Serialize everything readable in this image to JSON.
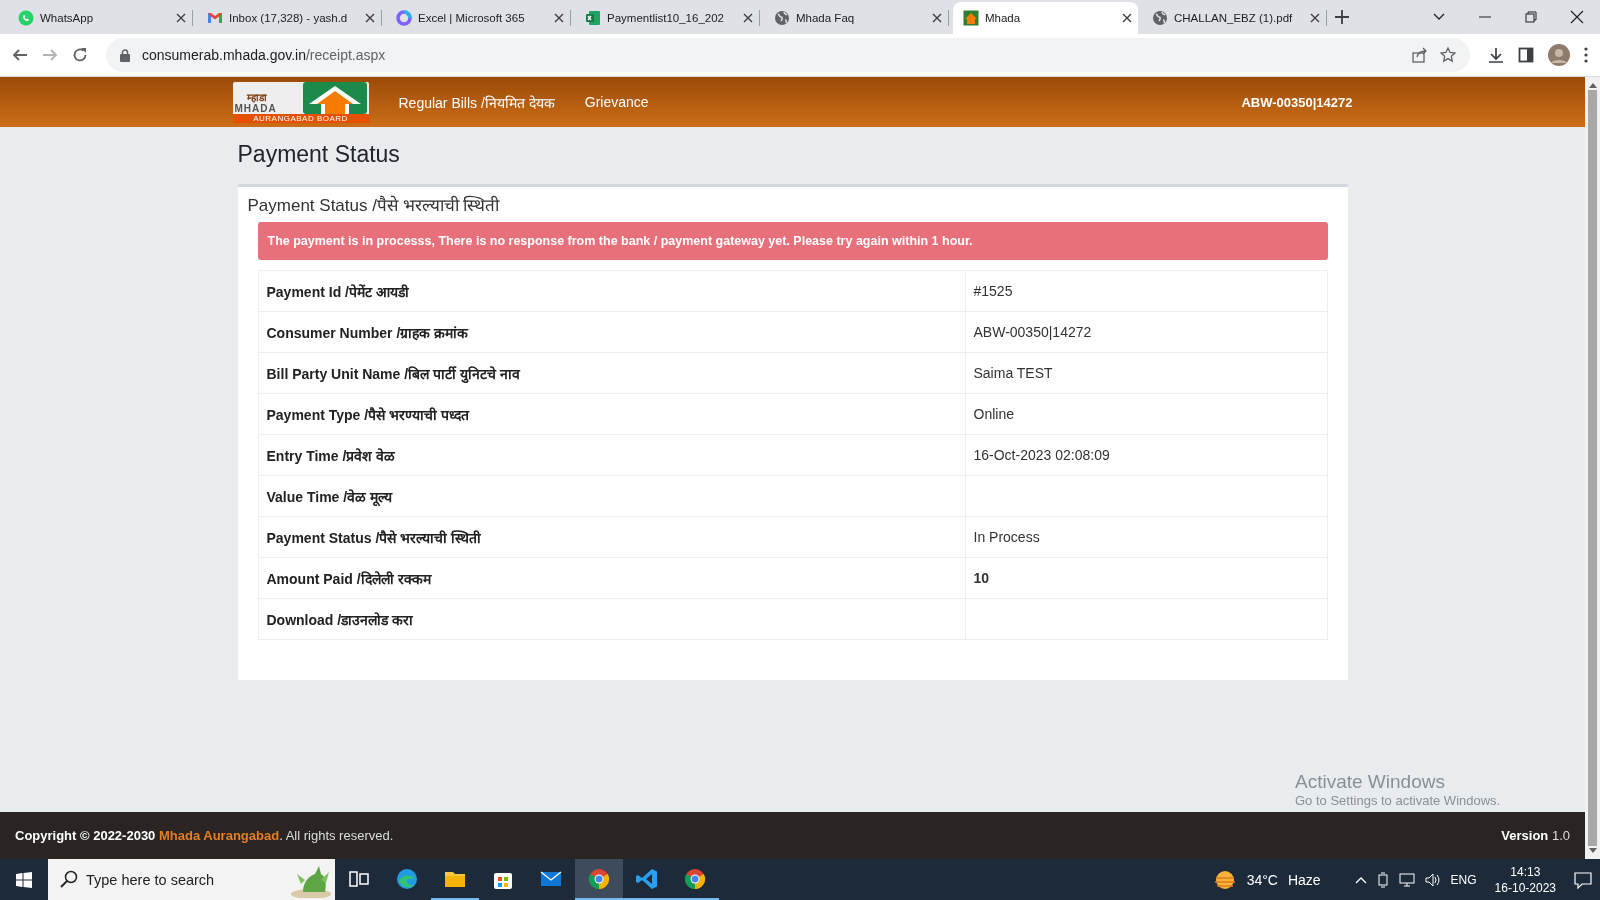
{
  "browser": {
    "tabs": [
      {
        "title": "WhatsApp",
        "kind": "chat",
        "selected": false
      },
      {
        "title": "Inbox (17,328) - yash.d",
        "kind": "mail",
        "selected": false
      },
      {
        "title": "Excel | Microsoft 365",
        "kind": "ring",
        "selected": false
      },
      {
        "title": "Paymentlist10_16_202",
        "kind": "sheet",
        "selected": false
      },
      {
        "title": "Mhada Faq",
        "kind": "web",
        "selected": false
      },
      {
        "title": "Mhada",
        "kind": "house",
        "selected": true
      },
      {
        "title": "CHALLAN_EBZ (1).pdf",
        "kind": "web",
        "selected": false
      }
    ],
    "address": {
      "domain": "consumerab.mhada.gov.in",
      "path": "/receipt.aspx"
    }
  },
  "header": {
    "logo": {
      "marathi": "म्हाडा",
      "name": "MHADA",
      "board": "AURANGABAD BOARD"
    },
    "nav": [
      "Regular Bills /नियमित देयक",
      "Grievance"
    ],
    "account": "ABW-00350|14272"
  },
  "page": {
    "title": "Payment Status",
    "card_title": "Payment Status /पैसे भरल्याची स्थिती",
    "alert": "The payment is in processs, There is no response from the bank / payment gateway yet. Please try again within 1 hour.",
    "rows": [
      {
        "label": "Payment Id /पेमेंट आयडी",
        "value": "#1525",
        "bold": false
      },
      {
        "label": "Consumer Number /ग्राहक क्रमांक",
        "value": "ABW-00350|14272",
        "bold": false
      },
      {
        "label": "Bill Party Unit Name /बिल पार्टी युनिटचे नाव",
        "value": "Saima TEST",
        "bold": false
      },
      {
        "label": "Payment Type /पैसे भरण्याची पध्दत",
        "value": "Online",
        "bold": false
      },
      {
        "label": "Entry Time /प्रवेश वेळ",
        "value": "16-Oct-2023 02:08:09",
        "bold": false
      },
      {
        "label": "Value Time /वेळ मूल्य"
      },
      {
        "label": "Payment Status /पैसे भरल्याची स्थिती",
        "value": "In Process",
        "bold": false
      },
      {
        "label": "Amount Paid /दिलेली रक्कम",
        "value": "10",
        "bold": true
      },
      {
        "label": "Download /डाउनलोड करा"
      }
    ]
  },
  "footer": {
    "copyright": "**Copyright © 2022-2030** ",
    "link": "Mhada Aurangabad",
    "suffix": ". All rights reserved.",
    "version": "**Version** 1.0"
  },
  "activation_notice": {
    "title": "Activate Windows",
    "hint": "Go to Settings to activate Windows."
  },
  "taskbar": {
    "search_placeholder": "Type here to search",
    "apps": [
      {
        "kind": "task-view",
        "running": false,
        "selected": false
      },
      {
        "kind": "edge",
        "running": false,
        "selected": false
      },
      {
        "kind": "explorer",
        "running": true,
        "selected": false
      },
      {
        "kind": "store",
        "running": false,
        "selected": false
      },
      {
        "kind": "mail",
        "running": false,
        "selected": false
      },
      {
        "kind": "chrome",
        "running": true,
        "selected": true
      },
      {
        "kind": "vscode",
        "running": true,
        "selected": false
      },
      {
        "kind": "chrome",
        "running": true,
        "selected": false
      }
    ],
    "weather": {
      "temperature": "34°C",
      "condition": "Haze"
    },
    "language": "ENG",
    "time": "14:13",
    "date": "16-10-2023"
  }
}
